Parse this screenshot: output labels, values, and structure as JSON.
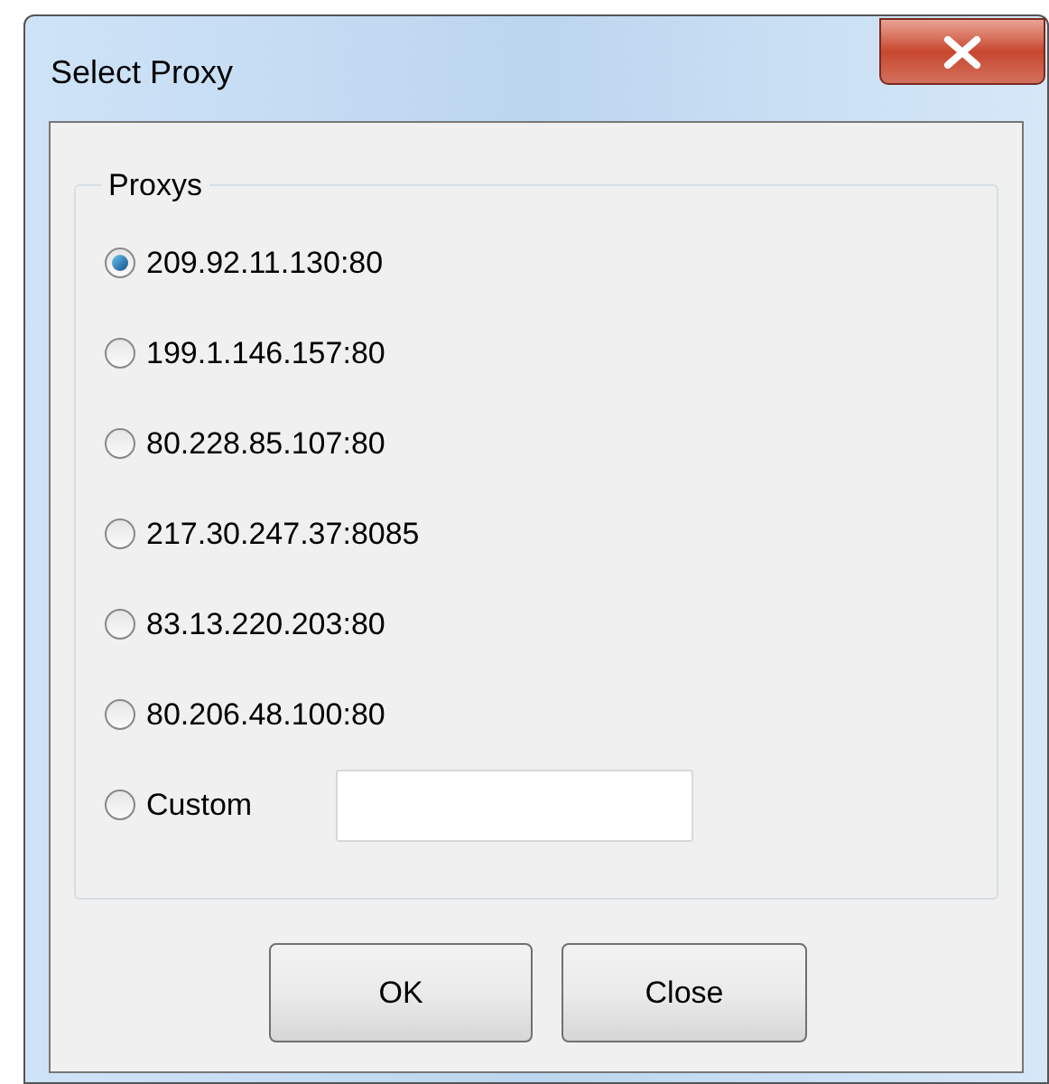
{
  "window": {
    "title": "Select Proxy"
  },
  "group": {
    "title": "Proxys"
  },
  "options": [
    {
      "label": "209.92.11.130:80",
      "selected": true,
      "kind": "radio"
    },
    {
      "label": "199.1.146.157:80",
      "selected": false,
      "kind": "radio"
    },
    {
      "label": "80.228.85.107:80",
      "selected": false,
      "kind": "radio"
    },
    {
      "label": "217.30.247.37:8085",
      "selected": false,
      "kind": "radio"
    },
    {
      "label": "83.13.220.203:80",
      "selected": false,
      "kind": "radio"
    },
    {
      "label": "80.206.48.100:80",
      "selected": false,
      "kind": "radio"
    },
    {
      "label": "Custom",
      "selected": false,
      "kind": "custom"
    }
  ],
  "buttons": [
    "OK",
    "Close"
  ]
}
